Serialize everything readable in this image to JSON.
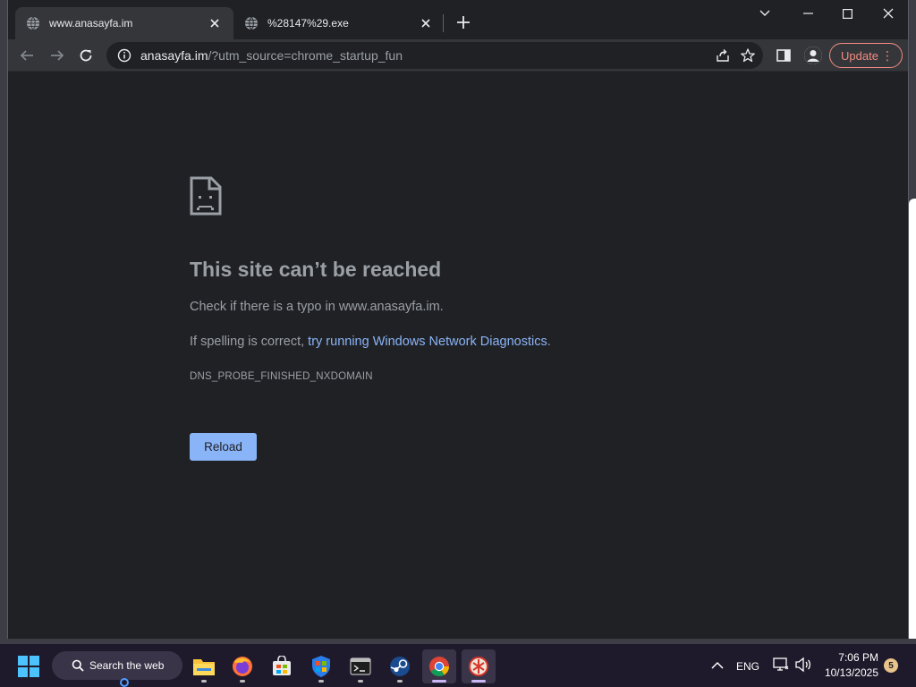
{
  "tabs": [
    {
      "title": "www.anasayfa.im",
      "icon": "globe-icon",
      "active": true
    },
    {
      "title": "%28147%29.exe",
      "icon": "globe-icon",
      "active": false
    }
  ],
  "window_controls": [
    "tab-search-icon",
    "minimize-icon",
    "maximize-icon",
    "close-icon"
  ],
  "omnibox": {
    "host": "anasayfa.im",
    "rest": "/?utm_source=chrome_startup_fun"
  },
  "toolbar": {
    "update_label": "Update"
  },
  "error_page": {
    "title": "This site can’t be reached",
    "line1": "Check if there is a typo in www.anasayfa.im.",
    "line2_prefix": "If spelling is correct, ",
    "line2_link": "try running Windows Network Diagnostics",
    "line2_suffix": ".",
    "error_code": "DNS_PROBE_FINISHED_NXDOMAIN",
    "reload_label": "Reload"
  },
  "taskbar": {
    "search_label": "Search the web",
    "apps": [
      {
        "name": "file-explorer-icon",
        "active": false
      },
      {
        "name": "firefox-icon",
        "active": false
      },
      {
        "name": "microsoft-store-icon",
        "active": false
      },
      {
        "name": "windows-security-icon",
        "active": false
      },
      {
        "name": "terminal-icon",
        "active": false
      },
      {
        "name": "steam-icon",
        "active": false
      },
      {
        "name": "chrome-icon",
        "active": true
      },
      {
        "name": "app-icon",
        "active": true
      }
    ],
    "tray": {
      "language": "ENG",
      "time": "7:06 PM",
      "date": "10/13/2025",
      "badge": "5"
    }
  },
  "colors": {
    "accent_blue": "#8ab4f8",
    "update_red": "#f28b82",
    "page_bg": "#202124",
    "toolbar_bg": "#35363a",
    "taskbar_bg": "#1f1a2b"
  }
}
